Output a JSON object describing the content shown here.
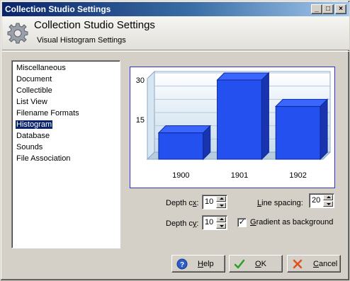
{
  "window": {
    "title": "Collection Studio Settings",
    "min_glyph": "_",
    "max_glyph": "□",
    "close_glyph": "×"
  },
  "header": {
    "title": "Collection Studio Settings",
    "subtitle": "Visual Histogram Settings",
    "icon": "gear-icon"
  },
  "nav": {
    "items": [
      {
        "label": "Miscellaneous",
        "selected": false
      },
      {
        "label": "Document",
        "selected": false
      },
      {
        "label": "Collectible",
        "selected": false
      },
      {
        "label": "List View",
        "selected": false
      },
      {
        "label": "Filename Formats",
        "selected": false
      },
      {
        "label": "Histogram",
        "selected": true
      },
      {
        "label": "Database",
        "selected": false
      },
      {
        "label": "Sounds",
        "selected": false
      },
      {
        "label": "File Association",
        "selected": false
      }
    ]
  },
  "chart_data": {
    "type": "bar",
    "categories": [
      "1900",
      "1901",
      "1902"
    ],
    "values": [
      10,
      30,
      20
    ],
    "ylim": [
      0,
      30
    ],
    "yticks": [
      "15",
      "30"
    ],
    "grid": true,
    "bar_color": "#2450f0",
    "title": "",
    "xlabel": "",
    "ylabel": ""
  },
  "settings": {
    "depth_cx_label_a": "Depth c",
    "depth_cx_label_b": "x",
    "depth_cx_label_c": ":",
    "depth_cx_value": "10",
    "depth_cy_label_a": "Depth c",
    "depth_cy_label_b": "y",
    "depth_cy_label_c": ":",
    "depth_cy_value": "10",
    "line_spacing_label_a": "",
    "line_spacing_label_b": "L",
    "line_spacing_label_c": "ine spacing:",
    "line_spacing_value": "20",
    "gradient_checked": true,
    "gradient_check_glyph": "✓",
    "gradient_label_a": "G",
    "gradient_label_b": "radient as background"
  },
  "buttons": {
    "help_a": "H",
    "help_b": "elp",
    "ok_a": "O",
    "ok_b": "K",
    "cancel_a": "C",
    "cancel_b": "ancel"
  },
  "colors": {
    "titlebar_start": "#0a246a",
    "accent": "#0a246a",
    "chart_border": "#3030d0"
  }
}
